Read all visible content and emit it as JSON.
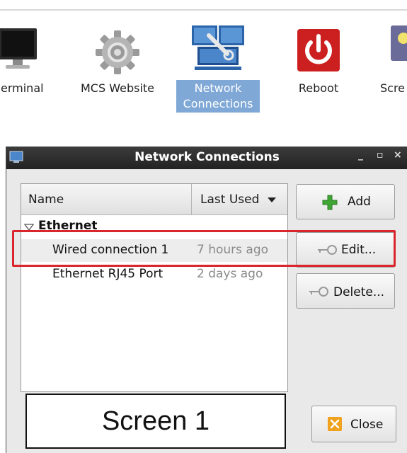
{
  "launcher": {
    "items": [
      {
        "label": "erminal",
        "icon": "terminal-icon"
      },
      {
        "label": "MCS Website",
        "icon": "gear-icon"
      },
      {
        "label": "Network\nConnections",
        "line1": "Network",
        "line2": "Connections",
        "icon": "network-icon",
        "selected": true
      },
      {
        "label": "Reboot",
        "icon": "power-icon"
      },
      {
        "label": "Scre",
        "icon": "screen-icon"
      }
    ]
  },
  "window": {
    "title": "Network Connections",
    "controls": {
      "minimize": "_",
      "maximize": "▫",
      "close": "×"
    },
    "list": {
      "columns": [
        "Name",
        "Last Used"
      ],
      "group": "Ethernet",
      "rows": [
        {
          "name": "Wired connection 1",
          "last_used": "7 hours ago",
          "selected": true
        },
        {
          "name": "Ethernet RJ45 Port",
          "last_used": "2 days ago",
          "selected": false
        }
      ]
    },
    "buttons": {
      "add": "Add",
      "edit": "Edit...",
      "delete": "Delete...",
      "close": "Close"
    }
  },
  "caption": "Screen 1",
  "colors": {
    "selection": "#7fa8d6",
    "highlight": "#d9252b",
    "titlebar": "#2c2c2c",
    "add_green": "#3fa535",
    "close_orange": "#f0a11e"
  }
}
